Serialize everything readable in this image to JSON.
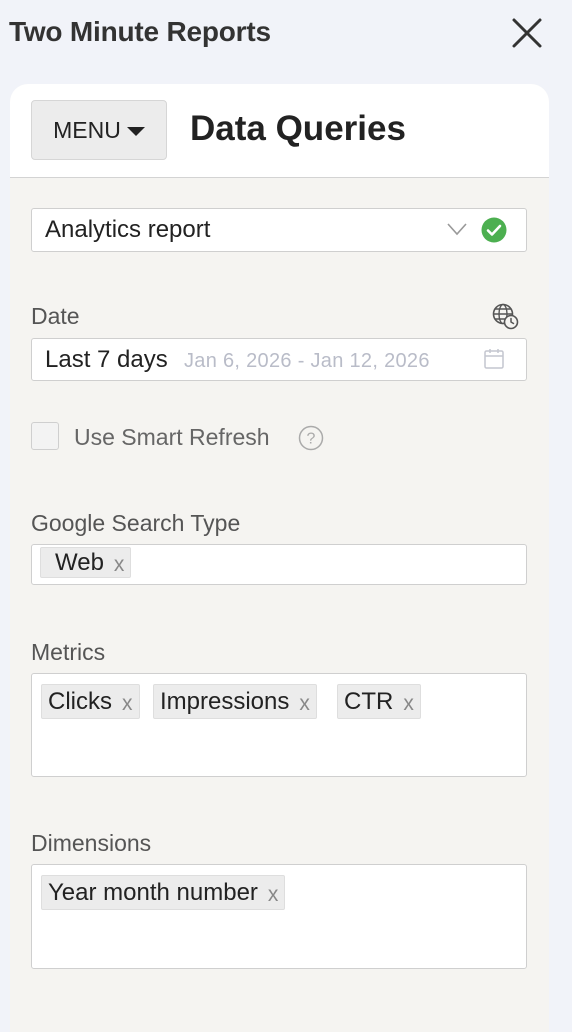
{
  "app": {
    "title": "Two Minute Reports"
  },
  "header": {
    "menu_label": "MENU",
    "page_title": "Data Queries"
  },
  "query_type": {
    "value": "Analytics report",
    "status": "valid",
    "status_color": "#4caf50"
  },
  "date": {
    "label": "Date",
    "value": "Last 7 days",
    "range": "Jan 6, 2026 - Jan 12, 2026"
  },
  "smart_refresh": {
    "label": "Use Smart Refresh",
    "checked": false
  },
  "search_type": {
    "label": "Google Search Type",
    "tags": [
      "Web"
    ]
  },
  "metrics": {
    "label": "Metrics",
    "tags": [
      "Clicks",
      "Impressions",
      "CTR"
    ]
  },
  "dimensions": {
    "label": "Dimensions",
    "tags": [
      "Year month number"
    ]
  },
  "tag_remove": "x"
}
